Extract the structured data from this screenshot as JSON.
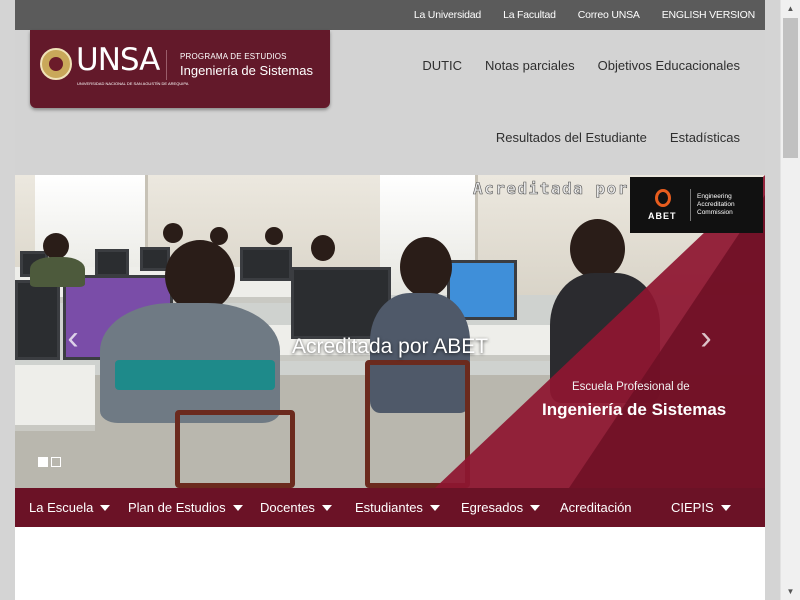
{
  "top_links": [
    "La Universidad",
    "La Facultad",
    "Correo UNSA",
    "ENGLISH VERSION"
  ],
  "brand": {
    "logo_text": "UNSA",
    "logo_subtext": "UNIVERSIDAD NACIONAL DE SAN AGUSTÍN DE AREQUIPA",
    "program_label": "PROGRAMA DE ESTUDIOS",
    "program_name": "Ingeniería de Sistemas"
  },
  "secondary_nav": {
    "row1": [
      "DUTIC",
      "Notas parciales",
      "Objetivos Educacionales"
    ],
    "row2": [
      "Resultados del Estudiante",
      "Estadísticas"
    ]
  },
  "slider": {
    "overlay_text": "Acreditada por",
    "abet_logo_word": "ABET",
    "abet_description": "Engineering Accreditation Commission",
    "caption": "Acreditada por ABET",
    "school_label": "Escuela Profesional de",
    "school_name": "Ingeniería de Sistemas",
    "prev_arrow": "‹",
    "next_arrow": "›",
    "slide_count": 2,
    "active_slide": 1
  },
  "main_nav": {
    "items": [
      {
        "label": "La Escuela",
        "dropdown": true
      },
      {
        "label": "Plan de Estudios",
        "dropdown": true
      },
      {
        "label": "Docentes",
        "dropdown": true
      },
      {
        "label": "Estudiantes",
        "dropdown": true
      },
      {
        "label": "Egresados",
        "dropdown": true
      },
      {
        "label": "Acreditación",
        "dropdown": false
      },
      {
        "label": "CIEPIS",
        "dropdown": true
      }
    ]
  },
  "colors": {
    "brand_maroon": "#63192a",
    "nav_maroon": "#6b1226",
    "topbar_gray": "#5b5b5b",
    "header_gray": "#d3d3d3",
    "abet_orange": "#e85d1e"
  },
  "scrollbar": {
    "up_icon": "▲",
    "down_icon": "▼"
  }
}
